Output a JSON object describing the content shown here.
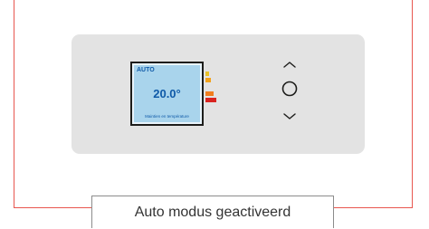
{
  "thermostat": {
    "mode": "AUTO",
    "temperature": "20.0°",
    "status_text": "Maintien en température"
  },
  "energy_label": {
    "colors": [
      "#e8c12a",
      "#f2a21b",
      "#f07d1e",
      "#d9231f"
    ]
  },
  "controls": {
    "up_icon": "chevron-up-icon",
    "center_icon": "circle-button-icon",
    "down_icon": "chevron-down-icon"
  },
  "caption": "Auto modus geactiveerd",
  "colors": {
    "frame": "#e8564f",
    "panel": "#e3e3e3",
    "lcd": "#a9d4ec",
    "lcd_text": "#0f5aa8"
  }
}
